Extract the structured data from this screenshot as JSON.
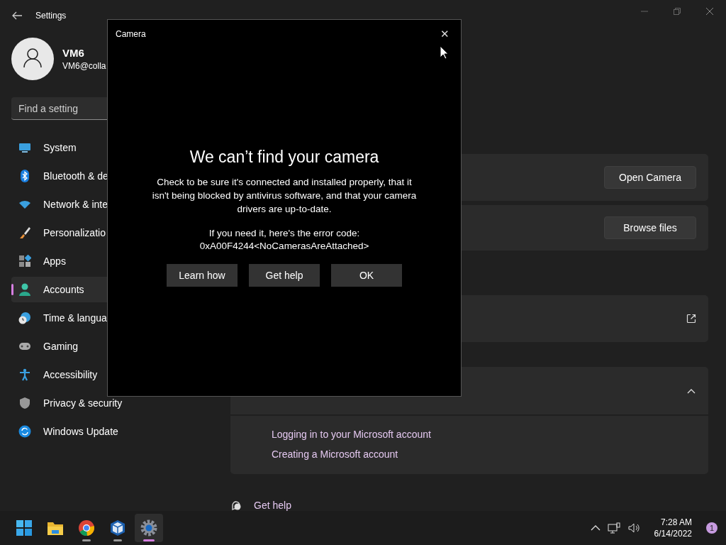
{
  "settings_window": {
    "title": "Settings"
  },
  "account": {
    "name": "VM6",
    "email": "VM6@colla"
  },
  "search": {
    "placeholder": "Find a setting"
  },
  "nav": [
    {
      "label": "System",
      "kind": "system",
      "selected": false
    },
    {
      "label": "Bluetooth & de",
      "kind": "bluetooth",
      "selected": false
    },
    {
      "label": "Network & inte",
      "kind": "wifi",
      "selected": false
    },
    {
      "label": "Personalizatio",
      "kind": "brush",
      "selected": false
    },
    {
      "label": "Apps",
      "kind": "apps",
      "selected": false
    },
    {
      "label": "Accounts",
      "kind": "person",
      "selected": true
    },
    {
      "label": "Time & langua",
      "kind": "clock",
      "selected": false
    },
    {
      "label": "Gaming",
      "kind": "gamepad",
      "selected": false
    },
    {
      "label": "Accessibility",
      "kind": "accessibility",
      "selected": false
    },
    {
      "label": "Privacy & security",
      "kind": "shield",
      "selected": false
    },
    {
      "label": "Windows Update",
      "kind": "update",
      "selected": false
    }
  ],
  "cards": [
    {
      "kind": "button",
      "button": "Open Camera"
    },
    {
      "kind": "button",
      "button": "Browse files"
    },
    {
      "kind": "external"
    },
    {
      "kind": "expander",
      "expanded": true,
      "links": [
        "Logging in to your Microsoft account",
        "Creating a Microsoft account"
      ]
    }
  ],
  "get_help": "Get help",
  "dialog": {
    "title": "Camera",
    "close": "✕",
    "heading": "We can’t find your camera",
    "message": "Check to be sure it's connected and installed properly, that it isn't being blocked by antivirus software, and that your camera drivers are up-to-date.",
    "error_intro": "If you need it, here's the error code:",
    "error_code": "0xA00F4244<NoCamerasAreAttached>",
    "buttons": [
      "Learn how",
      "Get help",
      "OK"
    ]
  },
  "taskbar": {
    "apps": [
      {
        "kind": "start",
        "running": false,
        "selected": false
      },
      {
        "kind": "folder",
        "running": false,
        "selected": false
      },
      {
        "kind": "browser",
        "running": true,
        "selected": false
      },
      {
        "kind": "cube",
        "running": true,
        "selected": false
      },
      {
        "kind": "gear",
        "running": true,
        "selected": true
      }
    ],
    "clock": {
      "time": "7:28 AM",
      "date": "6/14/2022"
    },
    "notifications": "1"
  }
}
